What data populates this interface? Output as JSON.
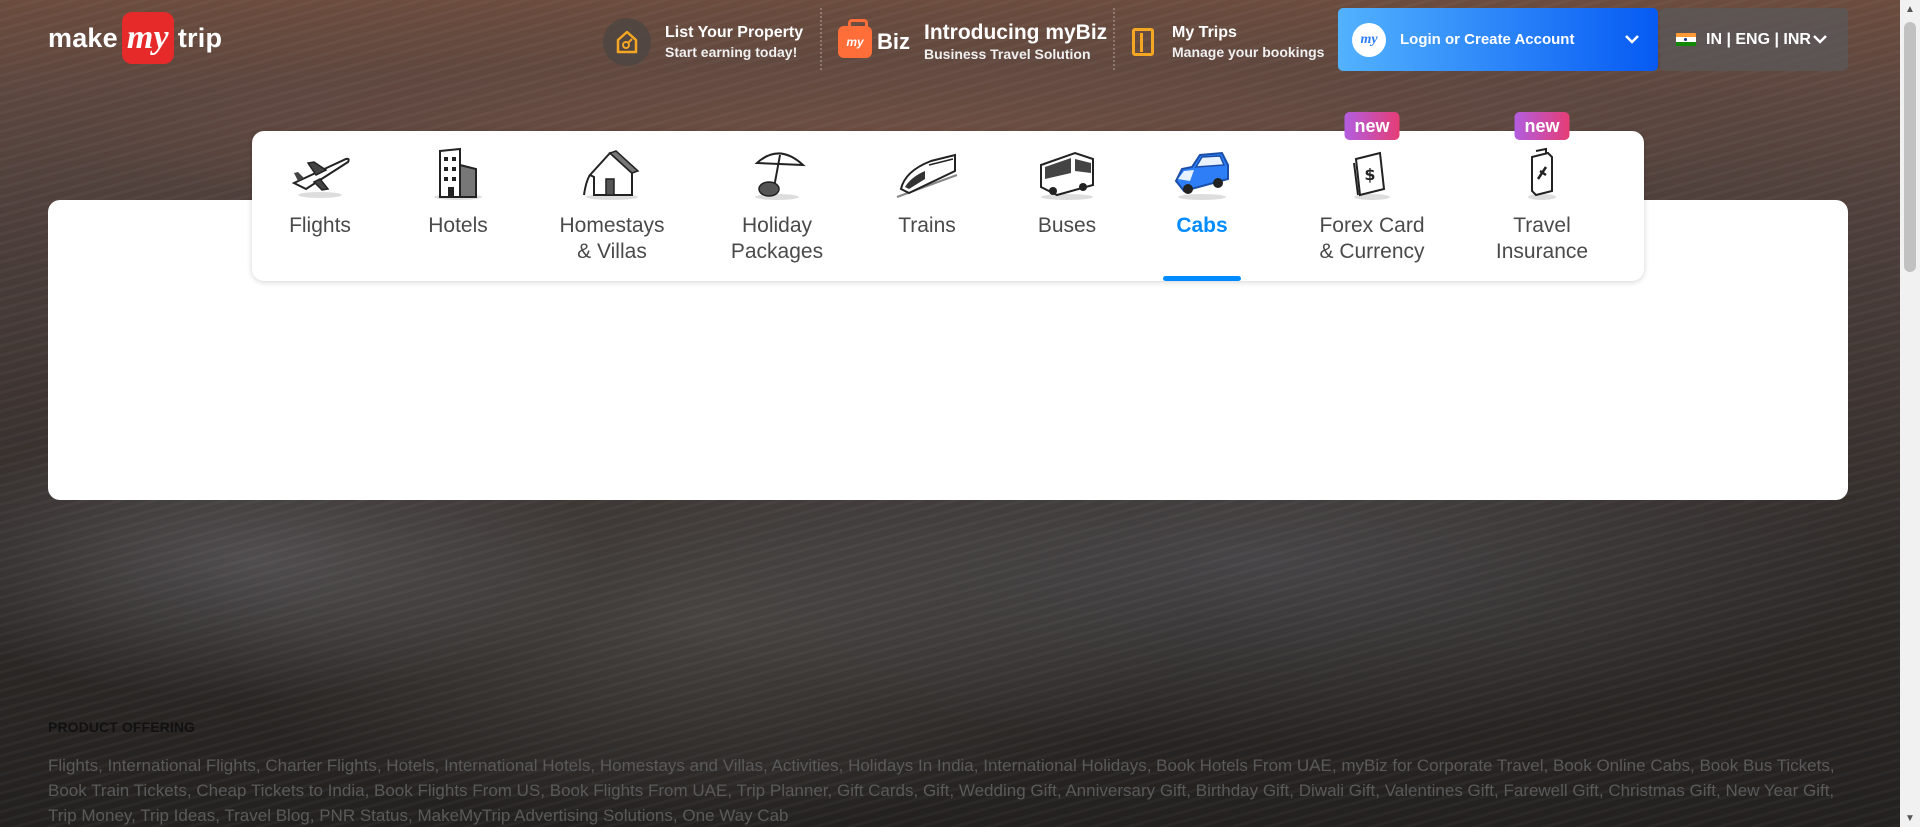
{
  "brand": {
    "part1": "make",
    "part2": "my",
    "part3": "trip"
  },
  "header": {
    "list_property": {
      "title": "List Your Property",
      "subtitle": "Start earning today!"
    },
    "mybiz": {
      "badge": "my",
      "badge_suffix": "Biz",
      "title": "Introducing myBiz",
      "subtitle": "Business Travel Solution"
    },
    "my_trips": {
      "title": "My Trips",
      "subtitle": "Manage your bookings"
    },
    "login": {
      "label": "Login or Create Account",
      "avatar": "my"
    },
    "locale": {
      "label": "IN | ENG | INR"
    }
  },
  "nav": {
    "items": [
      {
        "label": "Flights",
        "icon": "flight-icon"
      },
      {
        "label": "Hotels",
        "icon": "hotel-icon"
      },
      {
        "label": "Homestays\n& Villas",
        "icon": "homestay-icon"
      },
      {
        "label": "Holiday\nPackages",
        "icon": "holiday-icon"
      },
      {
        "label": "Trains",
        "icon": "train-icon"
      },
      {
        "label": "Buses",
        "icon": "bus-icon"
      },
      {
        "label": "Cabs",
        "icon": "cab-icon",
        "active": true
      },
      {
        "label": "Forex Card\n& Currency",
        "icon": "forex-icon",
        "badge": "new"
      },
      {
        "label": "Travel\nInsurance",
        "icon": "insurance-icon",
        "badge": "new"
      }
    ]
  },
  "footer": {
    "title": "PRODUCT OFFERING",
    "links": [
      "Flights",
      "International Flights",
      "Charter Flights",
      "Hotels",
      "International Hotels",
      "Homestays and Villas",
      "Activities",
      "Holidays In India",
      "International Holidays",
      "Book Hotels From UAE",
      "myBiz for Corporate Travel",
      "Book Online Cabs",
      "Book Bus Tickets",
      "Book Train Tickets",
      "Cheap Tickets to India",
      "Book Flights From US",
      "Book Flights From UAE",
      "Trip Planner",
      "Gift Cards",
      "Gift",
      "Wedding Gift",
      "Anniversary Gift",
      "Birthday Gift",
      "Diwali Gift",
      "Valentines Gift",
      "Farewell Gift",
      "Christmas Gift",
      "New Year Gift",
      "Trip Money",
      "Trip Ideas",
      "Travel Blog",
      "PNR Status",
      "MakeMyTrip Advertising Solutions",
      "One Way Cab"
    ]
  },
  "colors": {
    "accent": "#008cff",
    "brand_red": "#e62a2a",
    "login_gradient_start": "#53b2fe",
    "login_gradient_end": "#065af3",
    "badge_gradient_start": "#b25de0",
    "badge_gradient_end": "#e53d76"
  }
}
